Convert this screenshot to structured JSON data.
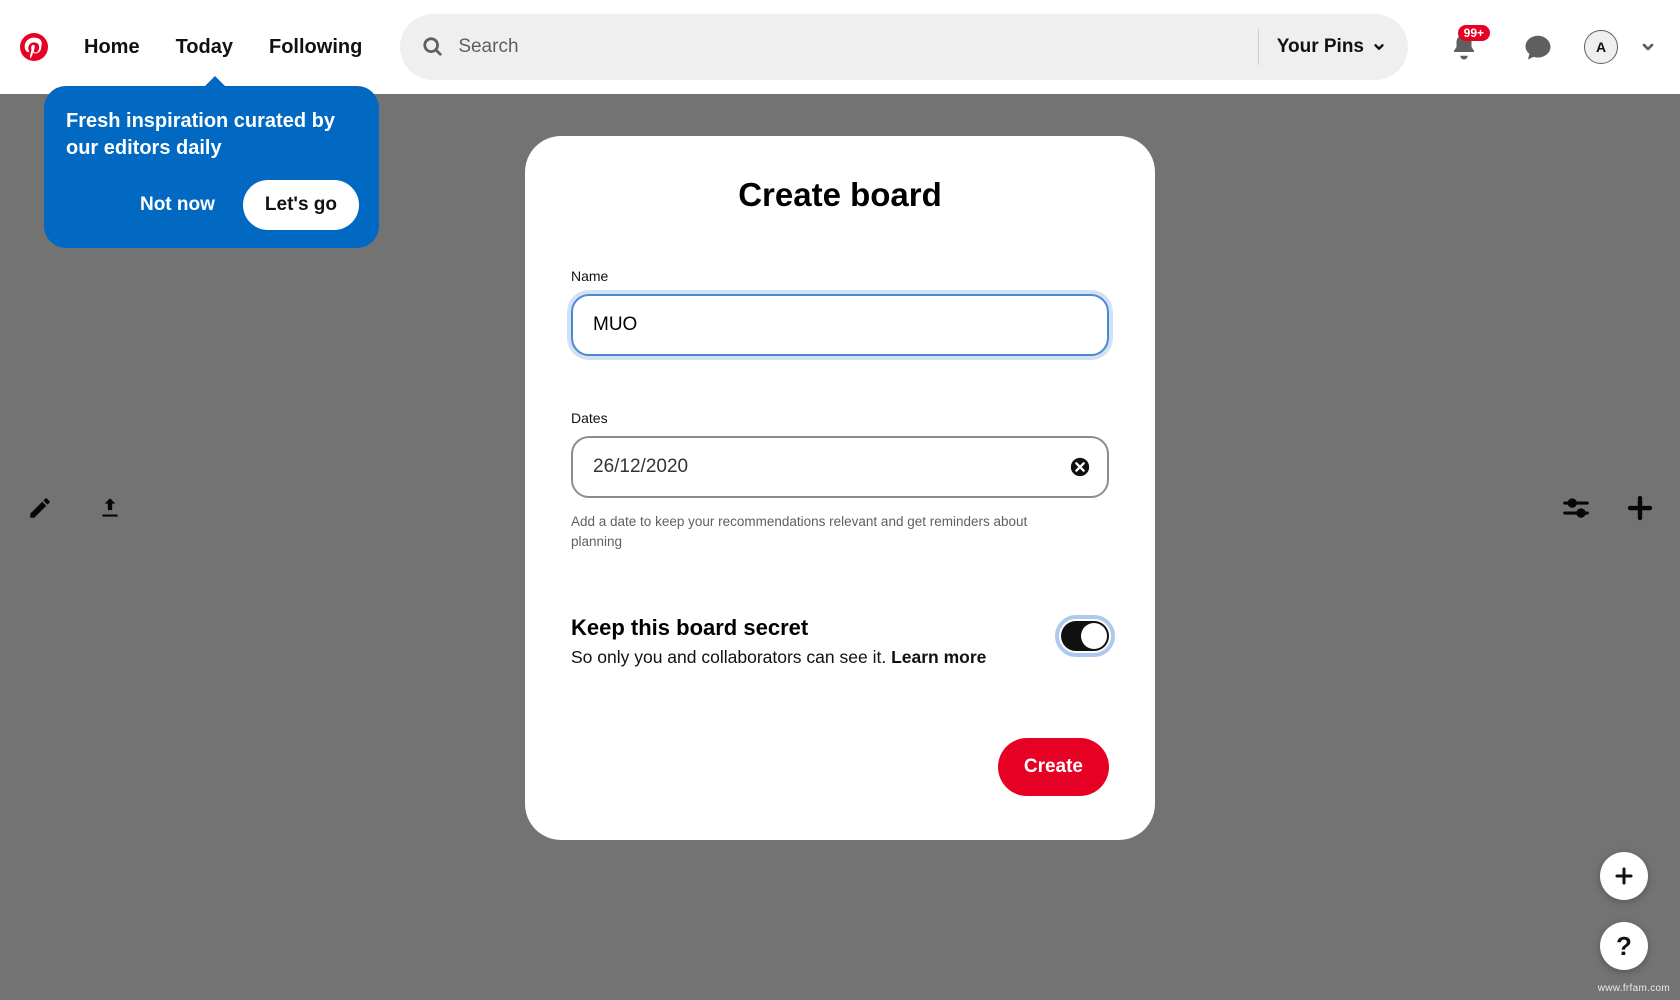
{
  "header": {
    "nav": {
      "home": "Home",
      "today": "Today",
      "following": "Following"
    },
    "search_placeholder": "Search",
    "your_pins": "Your Pins",
    "notification_badge": "99+",
    "avatar_initial": "A"
  },
  "tooltip": {
    "text": "Fresh inspiration curated by our editors daily",
    "dismiss": "Not now",
    "go": "Let's go"
  },
  "modal": {
    "title": "Create board",
    "name_label": "Name",
    "name_value": "MUO",
    "dates_label": "Dates",
    "dates_value": "26/12/2020",
    "dates_helper": "Add a date to keep your recommendations relevant and get reminders about planning",
    "secret_title": "Keep this board secret",
    "secret_desc_prefix": "So only you and collaborators can see it. ",
    "secret_learn": "Learn more",
    "create": "Create"
  },
  "watermark": "www.frfam.com"
}
